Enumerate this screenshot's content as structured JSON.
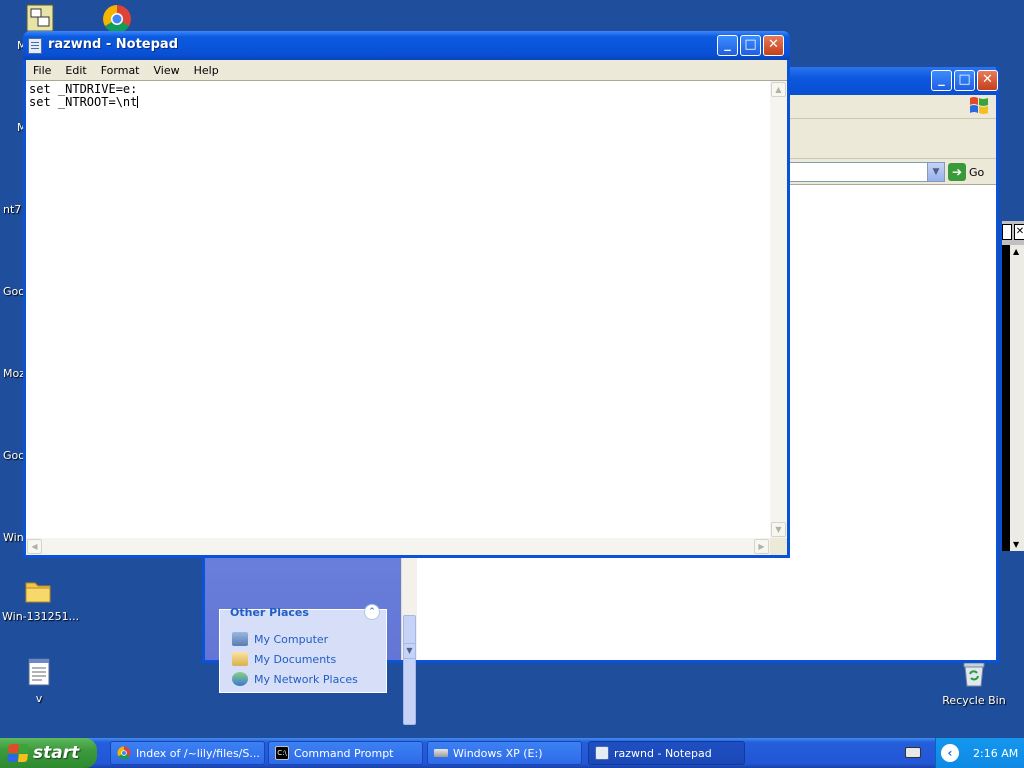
{
  "desktop": {
    "icons": [
      {
        "label": "Win-131251...",
        "icon": "folder-icon"
      },
      {
        "label": "v",
        "icon": "text-file-icon"
      },
      {
        "label": "Recycle Bin",
        "icon": "recycle-bin-icon"
      }
    ],
    "left_cut_labels": [
      "M",
      "M",
      "nt7",
      "Goo",
      "Moz",
      "Goo",
      "Win"
    ]
  },
  "explorer": {
    "go_label": "Go",
    "other_places": {
      "heading": "Other Places",
      "items": [
        "My Computer",
        "My Documents",
        "My Network Places"
      ]
    }
  },
  "notepad": {
    "title": "razwnd - Notepad",
    "menu": [
      "File",
      "Edit",
      "Format",
      "View",
      "Help"
    ],
    "lines": [
      "set _NTDRIVE=e:",
      "set _NTROOT=\\nt"
    ]
  },
  "taskbar": {
    "start_label": "start",
    "tasks": [
      {
        "label": "Index of /~lily/files/S...",
        "icon": "chrome-icon"
      },
      {
        "label": "Command Prompt",
        "icon": "cmd-icon"
      },
      {
        "label": "Windows XP (E:)",
        "icon": "drive-icon"
      },
      {
        "label": "razwnd - Notepad",
        "icon": "notepad-icon"
      }
    ],
    "clock": "2:16 AM"
  },
  "colors": {
    "desktop": "#1e4e9c",
    "titlebar": "#0a52d8",
    "start": "#3c9a3c",
    "task_link": "#215dc6"
  }
}
